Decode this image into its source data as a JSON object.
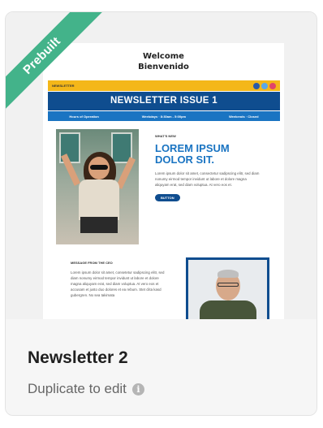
{
  "badge": "Prebuilt",
  "email": {
    "welcome_line1": "Welcome",
    "welcome_line2": "Bienvenido",
    "topbar_left": "NEWSLETTER",
    "title": "NEWSLETTER ISSUE 1",
    "nav": [
      "Hours of Operation",
      "Weekdays · 8:30am - 5:00pm",
      "Weekends · Closed"
    ],
    "kicker": "WHAT'S NEW",
    "headline_line1": "LOREM IPSUM",
    "headline_line2": "DOLOR SIT.",
    "body": "Lorem ipsum dolor sit amet, consectetur sadipscing elitr, sed diam nonumy eirmod tempor invidunt ut labore et dolore magna aliquyam erat, sed diam voluptua. At vero eos et.",
    "button": "BUTTON",
    "message_label": "MESSAGE FROM THE CEO",
    "message_body": "Lorem ipsum dolor sit amet, consetetur sadipscing elitr, sed diam nonumy eirmod tempor invidunt ut labore et dolore magna aliquyam erat, sed diam voluptua. At vero eos et accusam et justo duo dolores et ea rebum. Stet clita kasd gubergren. No sea takimata"
  },
  "card": {
    "title": "Newsletter 2",
    "subtitle": "Duplicate to edit",
    "info_glyph": "i"
  },
  "colors": {
    "badge": "#43b38a",
    "accent_yellow": "#f4b719",
    "navy": "#0f4d8f",
    "blue": "#1a74c2"
  }
}
